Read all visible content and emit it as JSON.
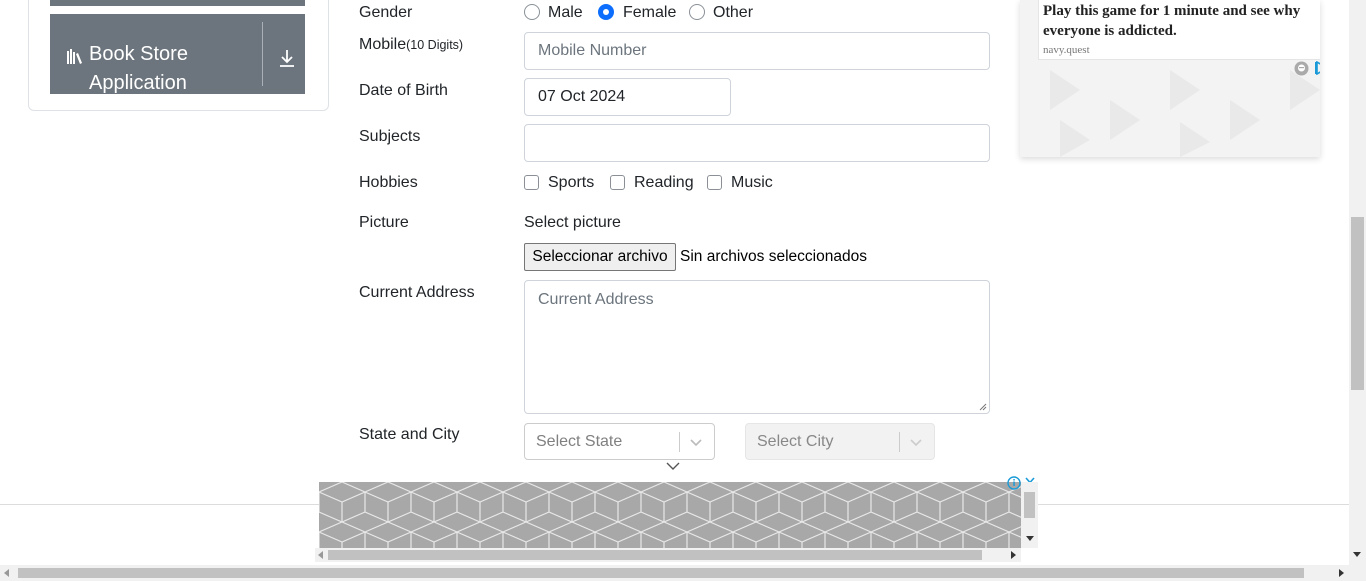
{
  "sidebar": {
    "item_label": "Book Store Application",
    "item_icon": "books-icon",
    "item_action_icon": "download-icon"
  },
  "form": {
    "gender": {
      "label": "Gender",
      "options": [
        "Male",
        "Female",
        "Other"
      ],
      "selected": "Female"
    },
    "mobile": {
      "label": "Mobile",
      "hint": "(10 Digits)",
      "placeholder": "Mobile Number"
    },
    "dob": {
      "label": "Date of Birth",
      "value": "07 Oct 2024"
    },
    "subjects": {
      "label": "Subjects",
      "value": ""
    },
    "hobbies": {
      "label": "Hobbies",
      "options": [
        "Sports",
        "Reading",
        "Music"
      ]
    },
    "picture": {
      "label": "Picture",
      "select_text": "Select picture",
      "button_label": "Seleccionar archivo",
      "status": "Sin archivos seleccionados"
    },
    "address": {
      "label": "Current Address",
      "placeholder": "Current Address"
    },
    "state_city": {
      "label": "State and City",
      "state_placeholder": "Select State",
      "city_placeholder": "Select City"
    }
  },
  "ad_right": {
    "headline": "Play this game for 1 minute and see why everyone is addicted.",
    "domain": "navy.quest"
  },
  "colors": {
    "accent": "#0d6efd",
    "sidebar_item": "#6c757d",
    "ad_link": "#1a9bd7"
  }
}
